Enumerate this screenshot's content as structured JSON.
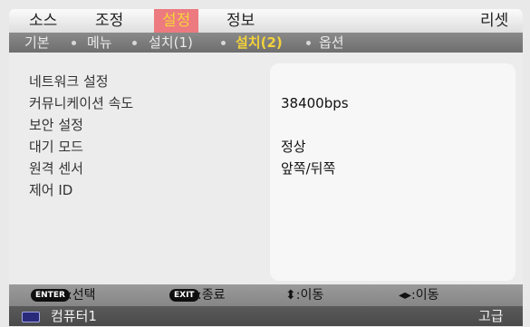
{
  "menu": {
    "items": [
      "소스",
      "조정",
      "설정",
      "정보"
    ],
    "active_index": 2,
    "reset_label": "리셋"
  },
  "subtabs": {
    "items": [
      "기본",
      "메뉴",
      "설치(1)",
      "설치(2)",
      "옵션"
    ],
    "active_index": 3
  },
  "settings": [
    {
      "label": "네트워크 설정",
      "value": ""
    },
    {
      "label": "커뮤니케이션 속도",
      "value": "38400bps"
    },
    {
      "label": "보안 설정",
      "value": ""
    },
    {
      "label": "대기 모드",
      "value": "정상"
    },
    {
      "label": "원격 센서",
      "value": "앞쪽/뒤쪽"
    },
    {
      "label": "제어 ID",
      "value": ""
    }
  ],
  "help": {
    "enter_key": "ENTER",
    "enter_text": ":선택",
    "exit_key": "EXIT",
    "exit_text": ":종료",
    "updown_text": "⬍:이동",
    "leftright_text": "◂▸:이동"
  },
  "status": {
    "source": "컴퓨터1",
    "mode": "고급"
  },
  "colors": {
    "active_tab_bg": "#ec7a7f",
    "active_tab_text": "#f6d43a",
    "active_subtab_text": "#f3d23a",
    "subbar_bg": "#7a7a7a"
  }
}
